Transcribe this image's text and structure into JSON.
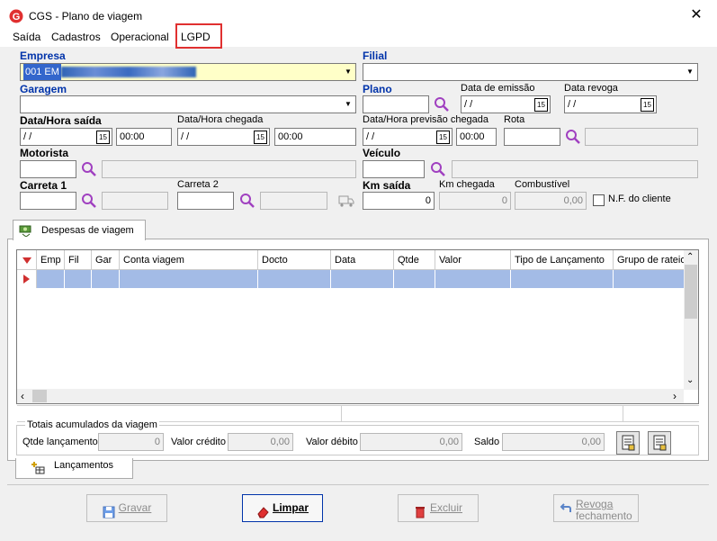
{
  "window": {
    "title": "CGS - Plano de viagem",
    "close": "✕"
  },
  "menu": [
    "Saída",
    "Cadastros",
    "Operacional",
    "LGPD"
  ],
  "form": {
    "empresa_label": "Empresa",
    "empresa_value": "001 EM",
    "filial_label": "Filial",
    "garagem_label": "Garagem",
    "plano_label": "Plano",
    "data_emissao_label": "Data de emissão",
    "data_emissao_value": "/ /",
    "data_revoga_label": "Data revoga",
    "data_revoga_value": "/ /",
    "data_hora_saida_label": "Data/Hora saída",
    "data_saida_value": "/ /",
    "hora_saida_value": "00:00",
    "data_hora_chegada_label": "Data/Hora chegada",
    "data_chegada_value": "/ /",
    "hora_chegada_value": "00:00",
    "data_hora_prev_label": "Data/Hora previsão chegada",
    "data_prev_value": "/ /",
    "hora_prev_value": "00:00",
    "rota_label": "Rota",
    "motorista_label": "Motorista",
    "veiculo_label": "Veículo",
    "carreta1_label": "Carreta 1",
    "carreta2_label": "Carreta 2",
    "km_saida_label": "Km saída",
    "km_saida_value": "0",
    "km_chegada_label": "Km chegada",
    "km_chegada_value": "0",
    "combustivel_label": "Combustível",
    "combustivel_value": "0,00",
    "nf_cliente_label": "N.F. do cliente",
    "calendar_glyph": "15"
  },
  "tabs": {
    "despesas": "Despesas de viagem",
    "lancamentos": "Lançamentos"
  },
  "grid": {
    "columns": [
      "Emp",
      "Fil",
      "Gar",
      "Conta viagem",
      "Docto",
      "Data",
      "Qtde",
      "Valor",
      "Tipo de Lançamento",
      "Grupo de rateio"
    ]
  },
  "totals": {
    "legend": "Totais acumulados da viagem",
    "qtde_label": "Qtde lançamento",
    "qtde_value": "0",
    "credito_label": "Valor crédito",
    "credito_value": "0,00",
    "debito_label": "Valor débito",
    "debito_value": "0,00",
    "saldo_label": "Saldo",
    "saldo_value": "0,00"
  },
  "buttons": {
    "gravar": "Gravar",
    "limpar": "Limpar",
    "excluir": "Excluir",
    "revoga_line1": "Revoga",
    "revoga_line2": "fechamento"
  },
  "colors": {
    "accent": "#0033aa",
    "highlight_row": "#a3bbe6",
    "lgpd_box": "#e03030"
  }
}
